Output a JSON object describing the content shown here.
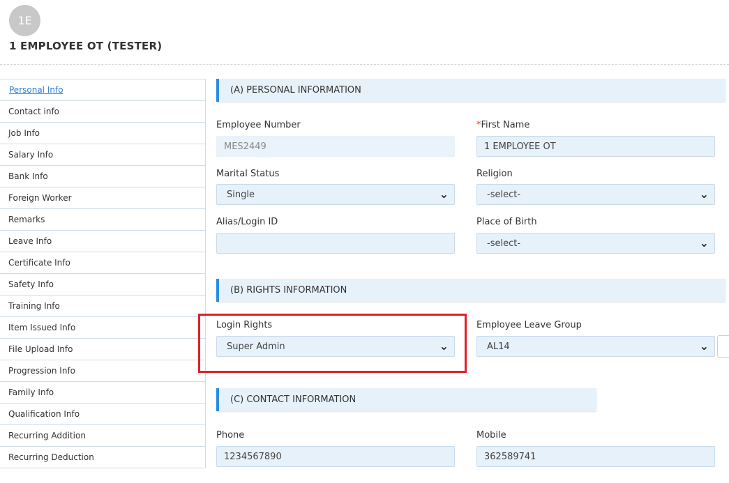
{
  "header": {
    "avatar_initials": "1E",
    "title": "1 EMPLOYEE OT (TESTER)"
  },
  "sidebar": {
    "items": [
      {
        "label": "Personal Info"
      },
      {
        "label": "Contact info"
      },
      {
        "label": "Job Info"
      },
      {
        "label": "Salary Info"
      },
      {
        "label": "Bank Info"
      },
      {
        "label": "Foreign Worker"
      },
      {
        "label": "Remarks"
      },
      {
        "label": "Leave Info"
      },
      {
        "label": "Certificate Info"
      },
      {
        "label": "Safety Info"
      },
      {
        "label": "Training Info"
      },
      {
        "label": "Item Issued Info"
      },
      {
        "label": "File Upload Info"
      },
      {
        "label": "Progression Info"
      },
      {
        "label": "Family Info"
      },
      {
        "label": "Qualification Info"
      },
      {
        "label": "Recurring Addition"
      },
      {
        "label": "Recurring Deduction"
      }
    ]
  },
  "personal": {
    "section_title": "(A) PERSONAL INFORMATION",
    "employee_number_label": "Employee Number",
    "employee_number_value": "MES2449",
    "first_name_required": "*",
    "first_name_label": "First Name",
    "first_name_value": "1 EMPLOYEE OT",
    "marital_status_label": "Marital Status",
    "marital_status_value": "Single",
    "religion_label": "Religion",
    "religion_value": "-select-",
    "alias_label": "Alias/Login ID",
    "alias_value": "",
    "place_of_birth_label": "Place of Birth",
    "place_of_birth_value": "-select-"
  },
  "rights": {
    "section_title": "(B) RIGHTS INFORMATION",
    "login_rights_label": "Login Rights",
    "login_rights_value": "Super Admin",
    "leave_group_label": "Employee Leave Group",
    "leave_group_value": "AL14"
  },
  "contact": {
    "section_title": "(C) CONTACT INFORMATION",
    "phone_label": "Phone",
    "phone_value": "1234567890",
    "mobile_label": "Mobile",
    "mobile_value": "362589741"
  },
  "icons": {
    "dropdown": "chevron-down-icon"
  },
  "colors": {
    "accent": "#2a8be0",
    "link": "#2a7fd4",
    "field_bg": "#e7f1fa",
    "highlight": "#e0202a",
    "required": "#e53935"
  }
}
